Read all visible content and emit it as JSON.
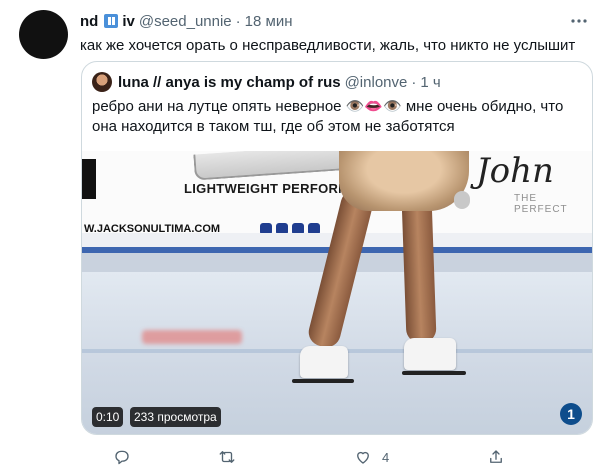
{
  "tweet": {
    "display_name": "nd",
    "name_suffix": "iv",
    "handle": "@seed_unnie",
    "separator": "·",
    "time": "18 мин",
    "more_icon": "more-icon",
    "text": "как же хочется орать о несправедливости, жаль, что никто не услышит"
  },
  "quote": {
    "display_name": "luna // anya is my champ of rus",
    "handle": "@inlonve",
    "separator": "·",
    "time": "1 ч",
    "text": "ребро ани на лутце опять неверное 👁️👄👁️ мне очень обидно, что она находится в таком тш, где об этом не заботятся",
    "media": {
      "board_text_1": "LIGHTWEIGHT PERFORM",
      "board_text_2": "W.JACKSONULTIMA.COM",
      "brand_script": "John",
      "brand_tagline": "THE PERFECT",
      "duration": "0:10",
      "views": "233 просмотра",
      "channel_logo": "1"
    }
  },
  "actions": {
    "reply_icon": "reply-icon",
    "retweet_icon": "retweet-icon",
    "like_icon": "like-icon",
    "like_count": "4",
    "share_icon": "share-icon"
  },
  "colors": {
    "text_primary": "#0f1419",
    "text_secondary": "#536471",
    "border": "#cfd9de",
    "badge": "#4a90d9"
  }
}
